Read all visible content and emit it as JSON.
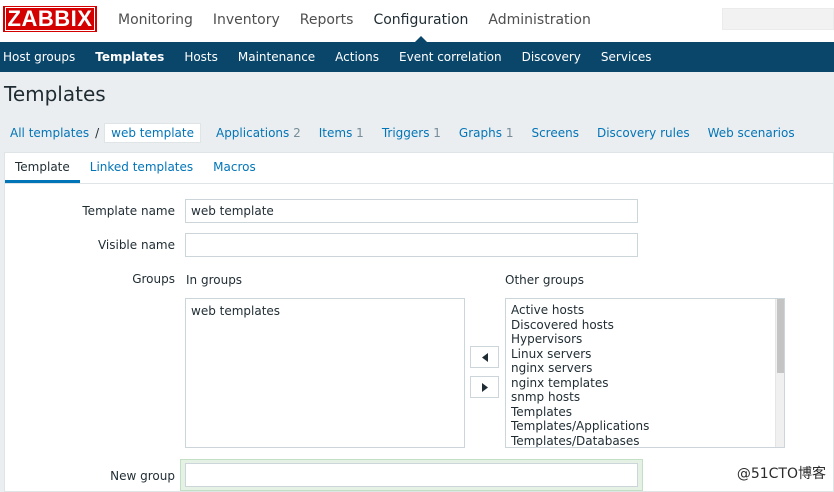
{
  "header": {
    "logo": "ZABBIX",
    "nav": [
      "Monitoring",
      "Inventory",
      "Reports",
      "Configuration",
      "Administration"
    ],
    "active_nav": "Configuration"
  },
  "subnav": {
    "items": [
      "Host groups",
      "Templates",
      "Hosts",
      "Maintenance",
      "Actions",
      "Event correlation",
      "Discovery",
      "Services"
    ],
    "active": "Templates"
  },
  "page": {
    "title": "Templates"
  },
  "breadcrumbs": {
    "all": "All templates",
    "separator": "/",
    "current": "web template",
    "links": [
      {
        "label": "Applications",
        "count": "2"
      },
      {
        "label": "Items",
        "count": "1"
      },
      {
        "label": "Triggers",
        "count": "1"
      },
      {
        "label": "Graphs",
        "count": "1"
      },
      {
        "label": "Screens",
        "count": ""
      },
      {
        "label": "Discovery rules",
        "count": ""
      },
      {
        "label": "Web scenarios",
        "count": ""
      }
    ]
  },
  "tabs": [
    "Template",
    "Linked templates",
    "Macros"
  ],
  "form": {
    "template_name_label": "Template name",
    "template_name_value": "web template",
    "visible_name_label": "Visible name",
    "visible_name_value": "",
    "groups_label": "Groups",
    "in_groups_label": "In groups",
    "other_groups_label": "Other groups",
    "in_groups": [
      "web templates"
    ],
    "other_groups": [
      "Active hosts",
      "Discovered hosts",
      "Hypervisors",
      "Linux servers",
      "nginx servers",
      "nginx templates",
      "snmp hosts",
      "Templates",
      "Templates/Applications",
      "Templates/Databases"
    ],
    "new_group_label": "New group",
    "new_group_value": ""
  },
  "watermark": "@51CTO博客"
}
